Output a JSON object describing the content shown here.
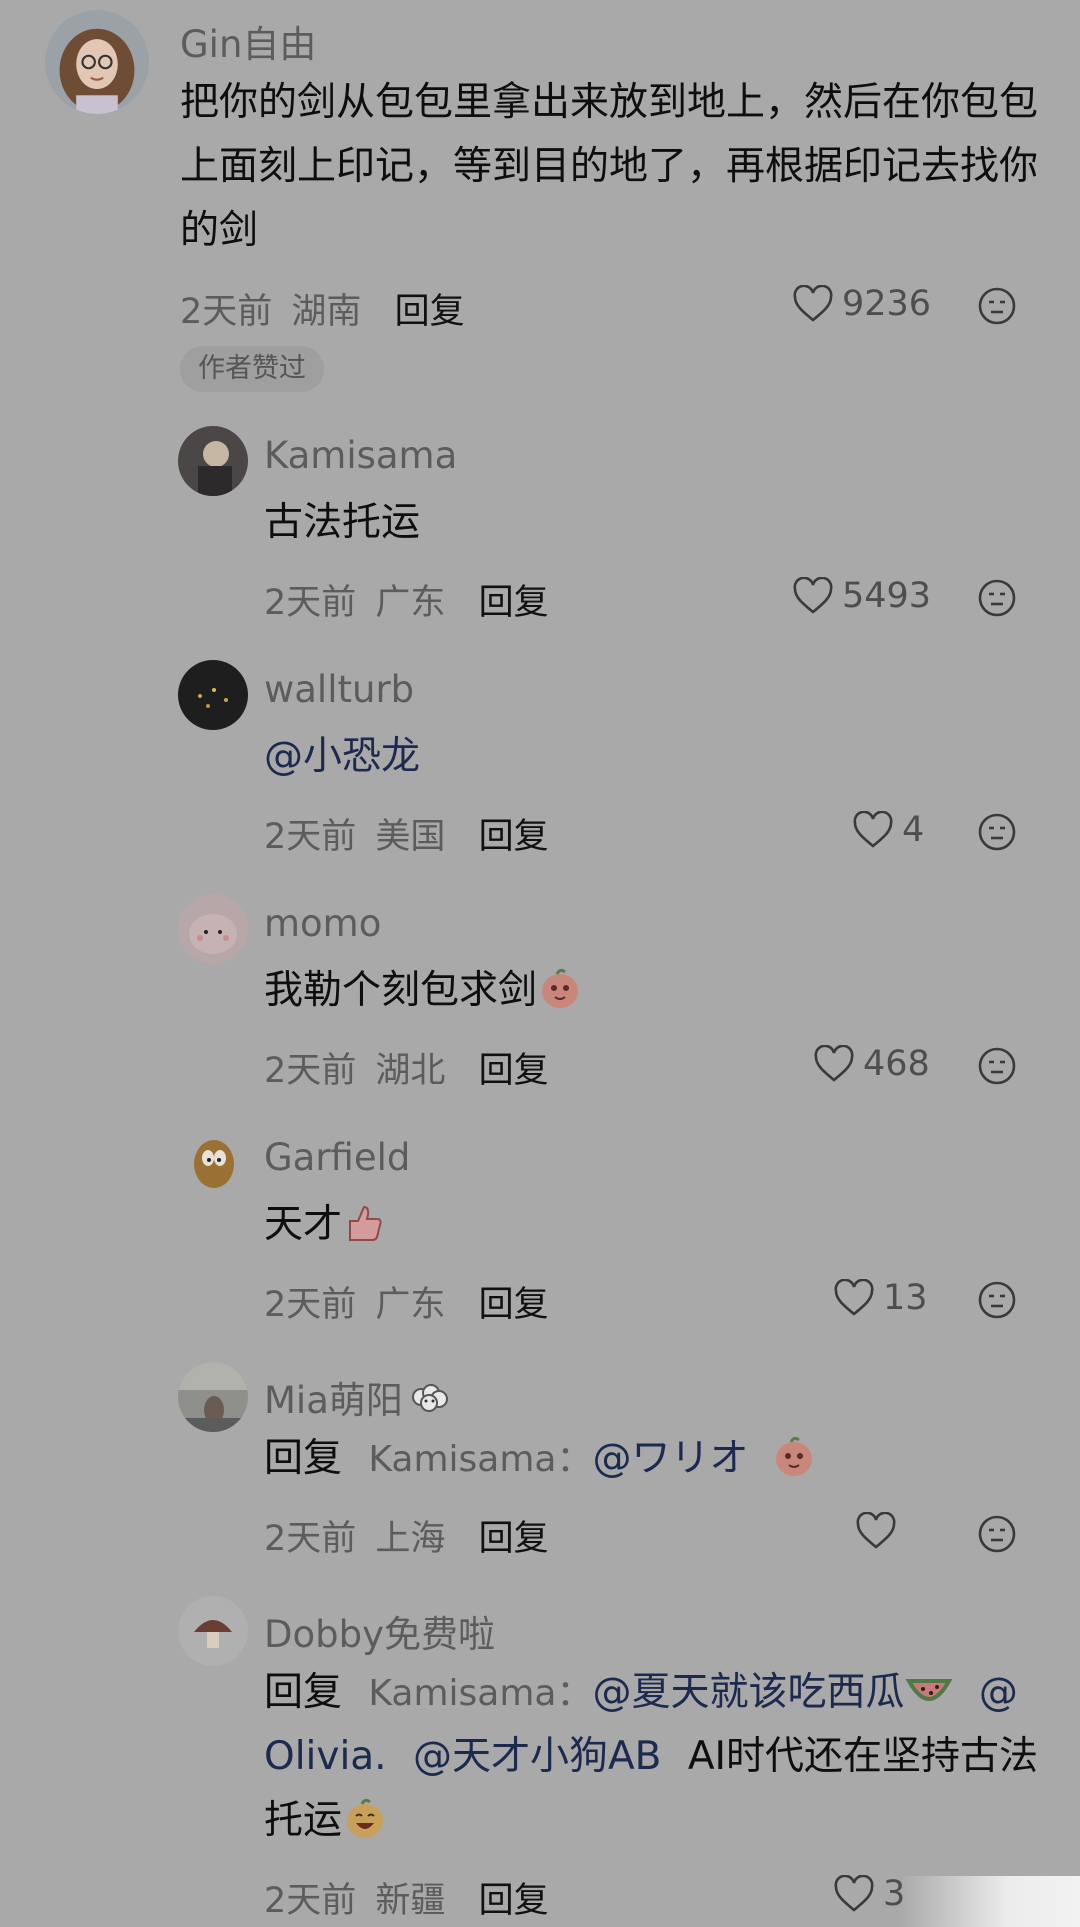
{
  "comments": [
    {
      "username": "Gin自由",
      "text": "把你的剑从包包里拿出来放到地上，然后在你包包上面刻上印记，等到目的地了，再根据印记去找你的剑",
      "time": "2天前",
      "location": "湖南",
      "reply_label": "回复",
      "likes": "9236",
      "badge": "作者赞过"
    },
    {
      "username": "Kamisama",
      "text": "古法托运",
      "time": "2天前",
      "location": "广东",
      "reply_label": "回复",
      "likes": "5493"
    },
    {
      "username": "wallturb",
      "mention": "@小恐龙",
      "time": "2天前",
      "location": "美国",
      "reply_label": "回复",
      "likes": "4"
    },
    {
      "username": "momo",
      "text": "我勒个刻包求剑",
      "time": "2天前",
      "location": "湖北",
      "reply_label": "回复",
      "likes": "468"
    },
    {
      "username": "Garfield",
      "text": "天才",
      "time": "2天前",
      "location": "广东",
      "reply_label": "回复",
      "likes": "13"
    },
    {
      "username": "Mia萌阳",
      "reply_prefix": "回复",
      "reply_target": "Kamisama：",
      "mention": "@ワリオ",
      "time": "2天前",
      "location": "上海",
      "reply_label": "回复",
      "likes": ""
    },
    {
      "username": "Dobby免费啦",
      "reply_prefix": "回复",
      "reply_target": "Kamisama：",
      "mention1": "@夏天就该吃西瓜",
      "mention2": "@",
      "mention3": "Olivia.",
      "mention4": "@天才小狗AB",
      "text": "AI时代还在坚持古法",
      "text2": "托运",
      "time": "2天前",
      "location": "新疆",
      "reply_label": "回复",
      "likes": "3"
    }
  ],
  "icons": {
    "like": "heart-outline-icon",
    "dislike": "meh-face-icon"
  },
  "colors": {
    "background": "#a9a9a9",
    "mention": "#1d2a4f",
    "meta": "#5c5c5c"
  }
}
